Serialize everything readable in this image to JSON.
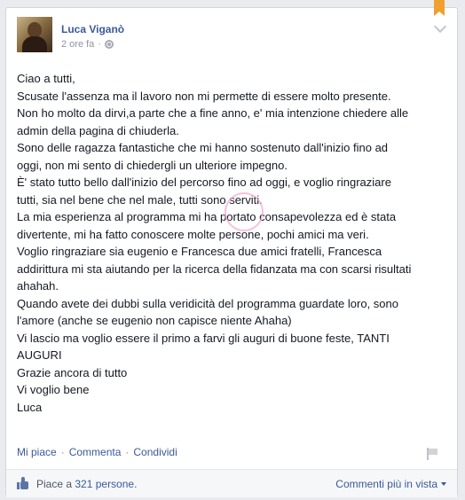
{
  "post": {
    "author": "Luca Viganò",
    "timestamp": "2 ore fa",
    "privacy_icon": "globe-icon",
    "body": "Ciao a tutti,\nScusate l'assenza ma il lavoro non mi permette di essere molto presente.\nNon ho molto da dirvi,a parte che a fine anno, e' mia intenzione chiedere alle\nadmin della pagina di chiuderla.\nSono delle ragazza fantastiche che mi hanno sostenuto dall'inizio fino ad\noggi, non mi sento di chiedergli un ulteriore impegno.\nÈ' stato tutto bello dall'inizio del percorso fino ad oggi, e voglio ringraziare\ntutti, sia nel bene che nel male, tutti sono serviti.\nLa mia esperienza al programma mi ha portato consapevolezza ed è stata\ndivertente, mi ha fatto conoscere molte persone, pochi amici ma veri.\nVoglio ringraziare sia eugenio e Francesca due amici fratelli, Francesca\naddirittura mi sta aiutando per la ricerca della fidanzata ma con scarsi risultati\nahahah.\nQuando avete dei dubbi sulla veridicità del programma guardate loro, sono\nl'amore (anche se eugenio non capisce niente Ahaha)\nVi lascio ma voglio essere il primo a farvi gli auguri di buone feste, TANTI\nAUGURI\nGrazie ancora di tutto\nVi voglio bene\nLuca"
  },
  "actions": {
    "like": "Mi piace",
    "comment": "Commenta",
    "share": "Condividi",
    "separator": "·"
  },
  "footer": {
    "likes_prefix": "Piace a ",
    "likes_link": "321 persone",
    "likes_suffix": ".",
    "more_comments": "Commenti più in vista"
  },
  "colors": {
    "link": "#3b5998",
    "text": "#141823",
    "muted": "#90949c",
    "bookmark": "#f0a030"
  }
}
